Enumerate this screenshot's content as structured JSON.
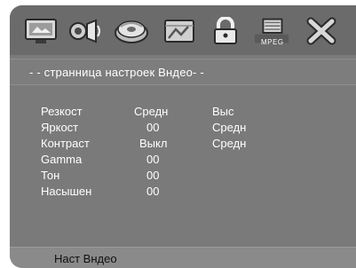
{
  "toolbar": {
    "icons": [
      {
        "name": "general-setup-icon"
      },
      {
        "name": "audio-setup-icon"
      },
      {
        "name": "video-setup-icon"
      },
      {
        "name": "preference-setup-icon"
      },
      {
        "name": "password-lock-icon"
      },
      {
        "name": "mpeg4-setup-icon",
        "label": "MPEG"
      },
      {
        "name": "exit-icon"
      }
    ]
  },
  "page": {
    "title": "- - странница  настроек Вндео- -"
  },
  "settings": {
    "rows": [
      {
        "label": "Резкост",
        "value": "Средн",
        "option": "Выс"
      },
      {
        "label": "Яркост",
        "value": "00",
        "option": "Средн"
      },
      {
        "label": "Контраст",
        "value": "Выкл",
        "option": "Средн"
      },
      {
        "label": "Gamma",
        "value": "00",
        "option": ""
      },
      {
        "label": "Тон",
        "value": "00",
        "option": ""
      },
      {
        "label": "Насышен",
        "value": "00",
        "option": ""
      }
    ]
  },
  "footer": {
    "label": "Наст Вндео"
  },
  "colors": {
    "background": "#7a7a7a",
    "text": "#ffffff",
    "footer_text": "#111111"
  }
}
